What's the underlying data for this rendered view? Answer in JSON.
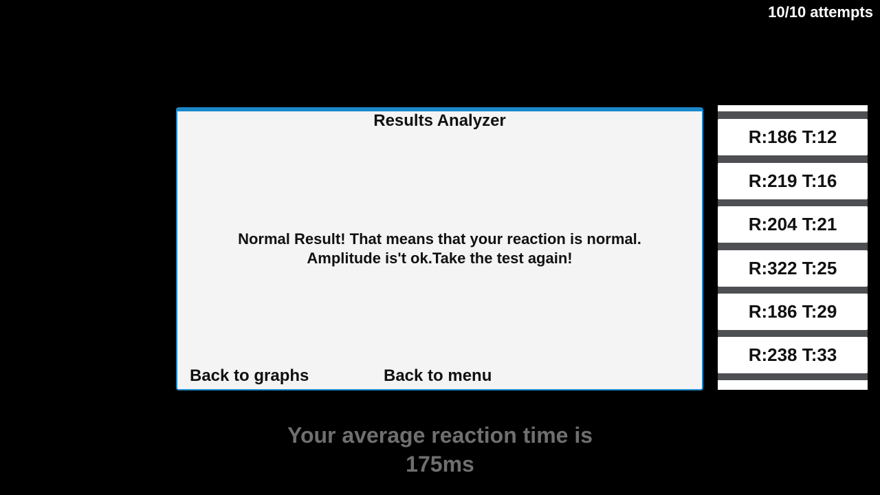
{
  "header": {
    "attempts_text": "10/10 attempts"
  },
  "dialog": {
    "title": "Results Analyzer",
    "message_line1": "Normal Result! That means that your reaction is normal.",
    "message_line2": "Amplitude is't ok.Take the test again!",
    "back_to_graphs_label": "Back to graphs",
    "back_to_menu_label": "Back to menu"
  },
  "results": [
    "R:186 T:12",
    "R:219 T:16",
    "R:204 T:21",
    "R:322 T:25",
    "R:186 T:29",
    "R:238 T:33"
  ],
  "footer": {
    "average_line1": "Your average reaction time is",
    "average_line2": "175ms"
  },
  "colors": {
    "background": "#000000",
    "dialog_accent": "#1a88c9",
    "dialog_background": "#f4f4f4",
    "list_background": "#4d4f52",
    "average_text": "#6f6f6f"
  }
}
